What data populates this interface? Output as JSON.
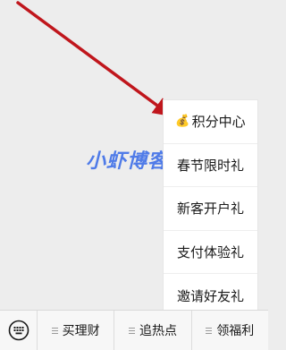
{
  "watermark": {
    "text": "小虾博客"
  },
  "popup_menu": {
    "items": [
      {
        "icon": "money-bag-icon",
        "icon_glyph": "💰",
        "label": "积分中心"
      },
      {
        "label": "春节限时礼"
      },
      {
        "label": "新客开户礼"
      },
      {
        "label": "支付体验礼"
      },
      {
        "label": "邀请好友礼"
      }
    ]
  },
  "bottom_bar": {
    "keyboard_icon": "keyboard-icon",
    "tabs": [
      {
        "label": "买理财"
      },
      {
        "label": "追热点"
      },
      {
        "label": "领福利"
      }
    ]
  },
  "colors": {
    "arrow": "#c0161c",
    "watermark": "#3f6fe8",
    "background": "#ededed"
  }
}
